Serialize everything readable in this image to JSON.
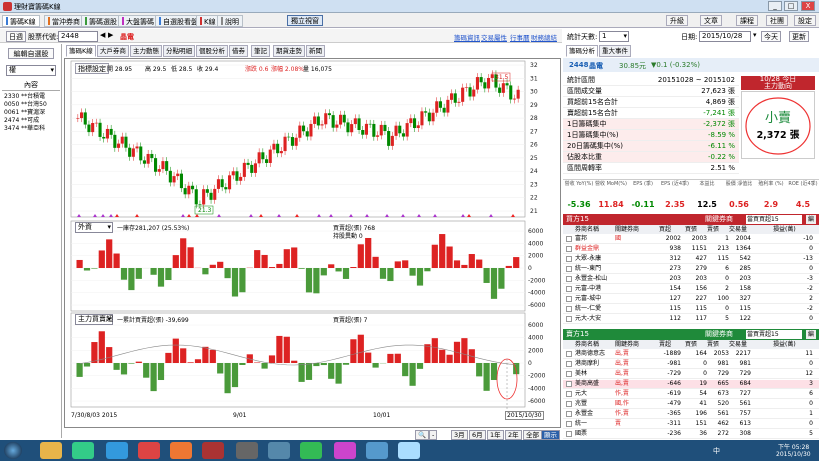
{
  "window": {
    "title": "理財寶籌碼K線",
    "min": "_",
    "max": "□",
    "close": "X"
  },
  "tabs": [
    {
      "label": "籌碼K線",
      "color": "#3a7bd5"
    },
    {
      "label": "當沖券商",
      "color": "#e07020"
    },
    {
      "label": "籌碼選股",
      "color": "#3a9a3a"
    },
    {
      "label": "大盤籌碼",
      "color": "#c030c0"
    },
    {
      "label": "自選股看盤",
      "color": "#3a7bd5"
    },
    {
      "label": "K線",
      "color": "#d03030"
    },
    {
      "label": "說明",
      "color": "#888888"
    }
  ],
  "float_btn": "獨立視窗",
  "right_btns": {
    "upgrade": "升級",
    "doc": "文章",
    "courses": "課程",
    "community": "社團",
    "settings": "設定"
  },
  "toolbar": {
    "date_btn": "日週",
    "code_label": "股票代號:",
    "code_value": "2448",
    "name": "晶電",
    "links": [
      "籌碼資訊",
      "交易屬性",
      "行事曆",
      "財務總結"
    ]
  },
  "left": {
    "title": "編輯自選股",
    "select": "權",
    "header": "內容",
    "items": [
      "2330 **台積電",
      "0050 **台灣50",
      "0061 **寶滬深",
      "2474 **可成",
      "3474 **華亞科"
    ]
  },
  "chart_tabs": [
    "籌碼K線",
    "大戶券商",
    "主力動態",
    "分點明細",
    "個股分析",
    "借券",
    "筆記",
    "期貨走勢",
    "新聞"
  ],
  "price_info": {
    "btn": "指標設定",
    "open": "開 28.95",
    "high": "高 29.5",
    "low": "低 28.5",
    "close": "收 29.4",
    "change": "漲跌 0.6",
    "pct": "漲幅 2.08%",
    "vol": "量 16,075"
  },
  "main_axis": [
    "32",
    "31",
    "30",
    "29",
    "28",
    "27",
    "26",
    "25",
    "24",
    "23",
    "22",
    "21"
  ],
  "max_label": "31.5",
  "min_label": "21.3",
  "sub1": {
    "select": "外資",
    "title": "一庫存281,207 (25.53%)",
    "legend1": "買賣超(張) 768",
    "legend2": "持股異動 0",
    "axis": [
      "6000",
      "4000",
      "2000",
      "0",
      "-2000",
      "-4000",
      "-6000"
    ]
  },
  "sub2": {
    "select": "主力買賣超",
    "title": "一累計買賣超(張) -39,699",
    "legend1": "買賣超(張) 7",
    "axis": [
      "6000",
      "4000",
      "2000",
      "0",
      "-2000",
      "-4000",
      "-6000"
    ]
  },
  "x_labels": [
    "7/30/8/03\n2015",
    "9/01",
    "10/01",
    "2015/10/30"
  ],
  "bottom": {
    "buttons": [
      "3月",
      "6月",
      "1年",
      "2年",
      "全部",
      "顯示"
    ]
  },
  "right": {
    "stat_label": "統計天數:",
    "stat_value": "1",
    "date_label": "日期:",
    "date_value": "2015/10/28",
    "today": "今天",
    "refresh": "更新",
    "tabs": [
      "籌碼分析",
      "重大事件"
    ],
    "stock": {
      "code": "2448",
      "name": "晶電",
      "price": "30.85元",
      "chg": "▼0.1 (-0.32%)"
    },
    "stats": [
      {
        "label": "統計區間",
        "value": "20151028 ~ 2015102"
      },
      {
        "label": "區間成交量",
        "value": "27,623 張"
      },
      {
        "label": "買超前15名合計",
        "value": "4,869 張"
      },
      {
        "label": "賣超前15名合計",
        "value": "-7,241 張"
      },
      {
        "label": "1日籌碼集中",
        "value": "-2,372 張"
      },
      {
        "label": "1日籌碼集中(%)",
        "value": "-8.59 %"
      },
      {
        "label": "20日籌碼集中(%)",
        "value": "-6.11 %"
      },
      {
        "label": "佔股本比重",
        "value": "-0.22 %"
      },
      {
        "label": "區間周轉率",
        "value": "2.51 %"
      }
    ],
    "box": {
      "title": "10/28 今日",
      "subtitle": "主力動向",
      "verdict": "小賣",
      "amount": "2,372 張"
    },
    "ratios": {
      "headers": [
        "營收 YoY(%)",
        "營收 MoM(%)",
        "EPS (季)",
        "EPS (近4季)",
        "本益比",
        "股價 淨值比",
        "殖利率 (%)",
        "ROE (近4季)"
      ],
      "values": [
        "-5.36",
        "11.84",
        "-0.11",
        "2.35",
        "12.5",
        "0.56",
        "2.9",
        "4.5"
      ]
    },
    "buy": {
      "title": "買方15",
      "link": "關鍵券商",
      "select": "當買買超15",
      "cols": [
        "券商名稱",
        "關鍵券商",
        "買超",
        "買張",
        "賣張",
        "交易量",
        "損益(萬)"
      ],
      "rows": [
        [
          "富邦",
          "國",
          "2002",
          "2003",
          "1",
          "2004",
          "-10"
        ],
        [
          "群益金鼎",
          "",
          "938",
          "1151",
          "213",
          "1364",
          "0"
        ],
        [
          "大眾-永康",
          "",
          "312",
          "427",
          "115",
          "542",
          "-13"
        ],
        [
          "統一-東門",
          "",
          "273",
          "279",
          "6",
          "285",
          "0"
        ],
        [
          "永豐金-松山",
          "",
          "203",
          "203",
          "0",
          "203",
          "-3"
        ],
        [
          "元富-中港",
          "",
          "154",
          "156",
          "2",
          "158",
          "-2"
        ],
        [
          "元富-城中",
          "",
          "127",
          "227",
          "100",
          "327",
          "2"
        ],
        [
          "統一-仁愛",
          "",
          "115",
          "115",
          "0",
          "115",
          "-2"
        ],
        [
          "元大-大安",
          "",
          "112",
          "117",
          "5",
          "122",
          "0"
        ]
      ]
    },
    "sell": {
      "title": "賣方15",
      "link": "關鍵券商",
      "select": "當買賣超15",
      "cols": [
        "券商名稱",
        "關鍵券商",
        "賣超",
        "買張",
        "賣張",
        "交易量",
        "損益(萬)"
      ],
      "rows": [
        [
          "港商德意志",
          "出,賣",
          "-1889",
          "164",
          "2053",
          "2217",
          "11"
        ],
        [
          "港商摩利",
          "出,賣",
          "-981",
          "0",
          "981",
          "981",
          "0"
        ],
        [
          "美林",
          "出,賣",
          "-729",
          "0",
          "729",
          "729",
          "12"
        ],
        [
          "美商高盛",
          "出,賣",
          "-646",
          "19",
          "665",
          "684",
          "3"
        ],
        [
          "元大",
          "作,賣",
          "-619",
          "54",
          "673",
          "727",
          "6"
        ],
        [
          "兆豐",
          "國,作",
          "-479",
          "41",
          "520",
          "561",
          "0"
        ],
        [
          "永豐金",
          "作,賣",
          "-365",
          "196",
          "561",
          "757",
          "1"
        ],
        [
          "統一",
          "賣",
          "-311",
          "151",
          "462",
          "613",
          "0"
        ],
        [
          "國票",
          "",
          "-236",
          "36",
          "272",
          "308",
          "5"
        ]
      ]
    }
  },
  "taskbar": {
    "time": "下午 05:28",
    "date": "2015/10/30",
    "lang": "中"
  }
}
